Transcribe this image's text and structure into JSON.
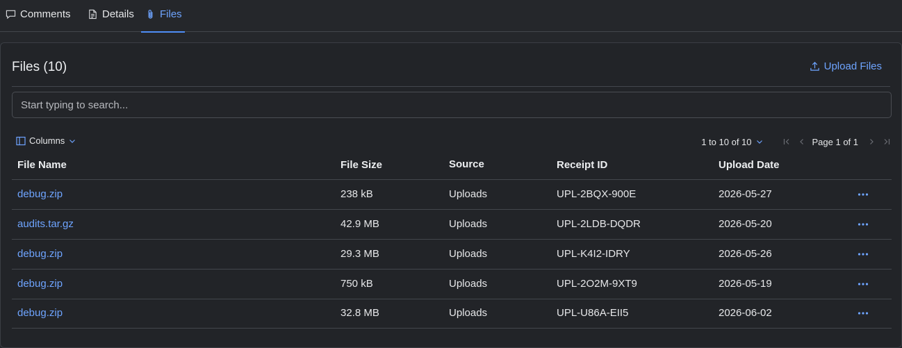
{
  "tabs": [
    {
      "label": "Comments",
      "icon": "comment-icon",
      "active": false
    },
    {
      "label": "Details",
      "icon": "document-icon",
      "active": false
    },
    {
      "label": "Files",
      "icon": "paperclip-icon",
      "active": true
    }
  ],
  "files_panel": {
    "title": "Files (10)",
    "upload_label": "Upload Files",
    "search_placeholder": "Start typing to search...",
    "columns_label": "Columns",
    "pager": {
      "range_label": "1 to 10 of 10",
      "page_label": "Page 1 of 1"
    }
  },
  "table": {
    "headers": {
      "file_name": "File Name",
      "file_size": "File Size",
      "source": "Source",
      "receipt_id": "Receipt ID",
      "upload_date": "Upload Date"
    },
    "rows": [
      {
        "file_name": "debug.zip",
        "file_size": "238 kB",
        "source": "Uploads",
        "receipt_id": "UPL-2BQX-900E",
        "upload_date": "2026-05-27"
      },
      {
        "file_name": "audits.tar.gz",
        "file_size": "42.9 MB",
        "source": "Uploads",
        "receipt_id": "UPL-2LDB-DQDR",
        "upload_date": "2026-05-20"
      },
      {
        "file_name": "debug.zip",
        "file_size": "29.3 MB",
        "source": "Uploads",
        "receipt_id": "UPL-K4I2-IDRY",
        "upload_date": "2026-05-26"
      },
      {
        "file_name": "debug.zip",
        "file_size": "750 kB",
        "source": "Uploads",
        "receipt_id": "UPL-2O2M-9XT9",
        "upload_date": "2026-05-19"
      },
      {
        "file_name": "debug.zip",
        "file_size": "32.8 MB",
        "source": "Uploads",
        "receipt_id": "UPL-U86A-EII5",
        "upload_date": "2026-06-02"
      }
    ]
  },
  "colors": {
    "background": "#25272b",
    "accent": "#6ea4ff",
    "text": "#e6e7e9",
    "border": "#44474d"
  }
}
